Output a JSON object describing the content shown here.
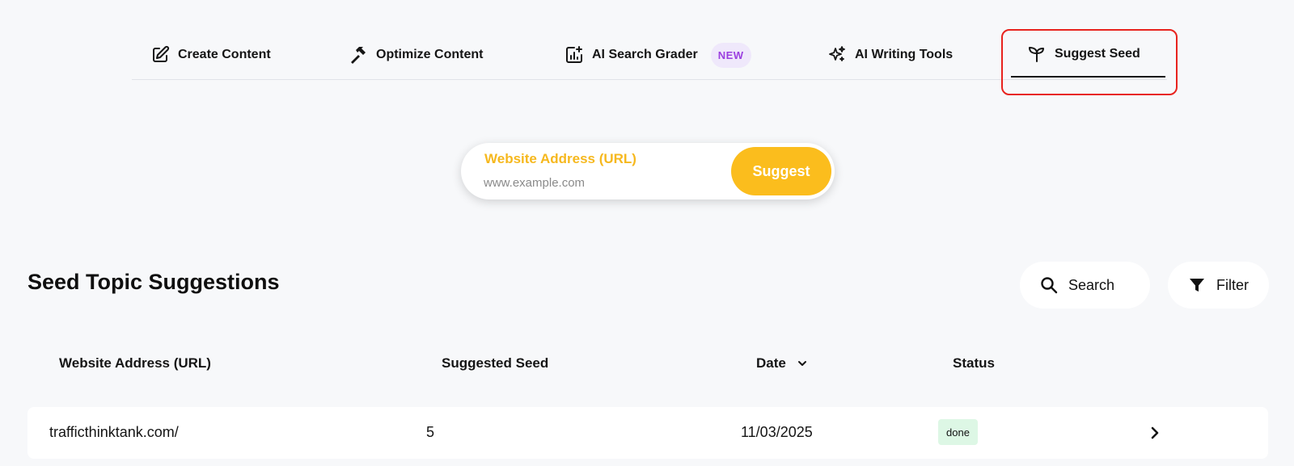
{
  "tabs": [
    {
      "label": "Create Content",
      "icon": "edit-icon"
    },
    {
      "label": "Optimize Content",
      "icon": "hammer-icon"
    },
    {
      "label": "AI Search Grader",
      "icon": "chart-icon",
      "badge": "NEW"
    },
    {
      "label": "AI Writing Tools",
      "icon": "sparkles-icon"
    },
    {
      "label": "Suggest Seed",
      "icon": "sprout-icon",
      "active": true
    }
  ],
  "suggest": {
    "label": "Website Address (URL)",
    "placeholder": "www.example.com",
    "value": "",
    "button": "Suggest"
  },
  "section": {
    "title": "Seed Topic Suggestions",
    "search_label": "Search",
    "filter_label": "Filter"
  },
  "table": {
    "headers": [
      "Website Address (URL)",
      "Suggested Seed",
      "Date",
      "Status"
    ],
    "rows": [
      {
        "url": "trafficthinktank.com/",
        "seeds": "5",
        "date": "11/03/2025",
        "status": "done"
      }
    ]
  },
  "colors": {
    "accent": "#fbbd1d",
    "label_accent": "#f6b81e",
    "badge_new_text": "#9b3fe0",
    "badge_new_bg": "#efe8fb",
    "status_done_bg": "#ddf7e5",
    "highlight": "#e8231e",
    "background": "#f7f8fa"
  }
}
